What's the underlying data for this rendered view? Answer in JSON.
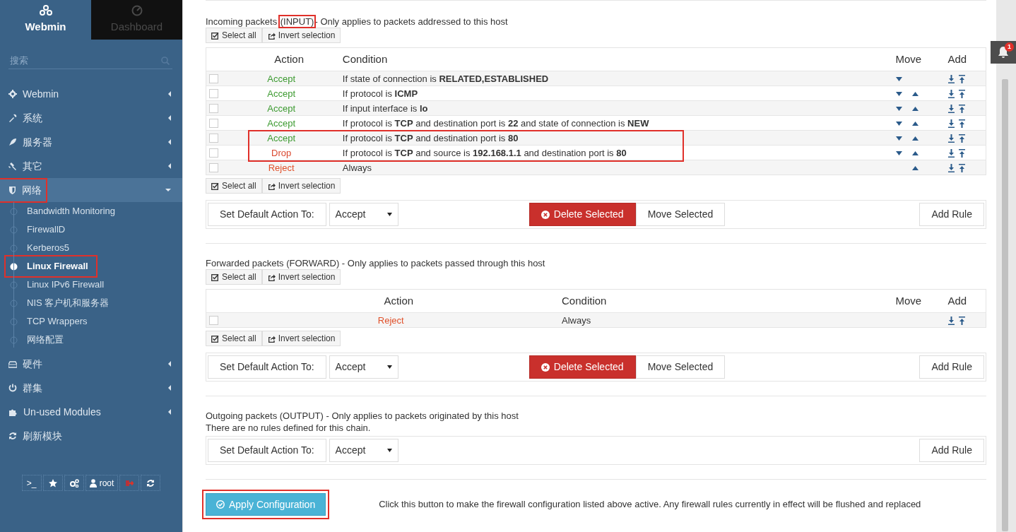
{
  "sidebar": {
    "tabs": [
      {
        "label": "Webmin",
        "selected": true
      },
      {
        "label": "Dashboard",
        "selected": false
      }
    ],
    "search": {
      "placeholder": "搜索"
    },
    "menu": [
      {
        "label": "Webmin",
        "expanded": false,
        "highlighted": false
      },
      {
        "label": "系统",
        "expanded": false,
        "highlighted": false
      },
      {
        "label": "服务器",
        "expanded": false,
        "highlighted": false
      },
      {
        "label": "其它",
        "expanded": false,
        "highlighted": false
      },
      {
        "label": "网络",
        "expanded": true,
        "highlighted": true,
        "children": [
          {
            "label": "Bandwidth Monitoring",
            "selected": false,
            "highlighted": false
          },
          {
            "label": "FirewallD",
            "selected": false,
            "highlighted": false
          },
          {
            "label": "Kerberos5",
            "selected": false,
            "highlighted": false
          },
          {
            "label": "Linux Firewall",
            "selected": true,
            "highlighted": true
          },
          {
            "label": "Linux IPv6 Firewall",
            "selected": false,
            "highlighted": false
          },
          {
            "label": "NIS 客户机和服务器",
            "selected": false,
            "highlighted": false
          },
          {
            "label": "TCP Wrappers",
            "selected": false,
            "highlighted": false
          },
          {
            "label": "网络配置",
            "selected": false,
            "highlighted": false
          }
        ]
      },
      {
        "label": "硬件",
        "expanded": false,
        "highlighted": false
      },
      {
        "label": "群集",
        "expanded": false,
        "highlighted": false
      },
      {
        "label": "Un-used Modules",
        "expanded": false,
        "highlighted": false
      },
      {
        "label": "刷新模块",
        "kind": "action",
        "highlighted": false
      }
    ],
    "footer": [
      {
        "kind": "terminal",
        "label": ">_"
      },
      {
        "kind": "star"
      },
      {
        "kind": "cogs"
      },
      {
        "kind": "user",
        "label": "root"
      },
      {
        "kind": "logout"
      },
      {
        "kind": "refresh"
      }
    ]
  },
  "notification": {
    "count": "1"
  },
  "chains": [
    {
      "title": [
        {
          "text": "Incoming packets ",
          "highlighted": false
        },
        {
          "text": "(INPUT)",
          "highlighted": true
        },
        {
          "text": "- Only applies to packets addressed to this host",
          "highlighted": false
        }
      ],
      "selection_bars": [
        {
          "select_all": "Select all",
          "invert_selection": "Invert selection"
        },
        {
          "select_all": "Select all",
          "invert_selection": "Invert selection"
        }
      ],
      "columns": {
        "action": "Action",
        "condition": "Condition",
        "move": "Move",
        "add": "Add"
      },
      "rules": [
        {
          "checked": false,
          "kind": "accept",
          "action": "Accept",
          "condition": "If state of connection is **RELATED,ESTABLISHED**",
          "move_down": true,
          "move_up": false,
          "highlighted": false
        },
        {
          "checked": false,
          "kind": "accept",
          "action": "Accept",
          "condition": "If protocol is **ICMP**",
          "move_down": true,
          "move_up": true,
          "highlighted": false
        },
        {
          "checked": false,
          "kind": "accept",
          "action": "Accept",
          "condition": "If input interface is **lo**",
          "move_down": true,
          "move_up": true,
          "highlighted": false
        },
        {
          "checked": false,
          "kind": "accept",
          "action": "Accept",
          "condition": "If protocol is **TCP** and destination port is **22** and state of connection is **NEW**",
          "move_down": true,
          "move_up": true,
          "highlighted": false
        },
        {
          "checked": false,
          "kind": "accept",
          "action": "Accept",
          "condition": "If protocol is **TCP** and destination port is **80**",
          "move_down": true,
          "move_up": true,
          "highlighted": true
        },
        {
          "checked": false,
          "kind": "drop",
          "action": "Drop",
          "condition": "If protocol is **TCP** and source is **192.168.1.1** and destination port is **80**",
          "move_down": true,
          "move_up": true,
          "highlighted": true
        },
        {
          "checked": false,
          "kind": "reject",
          "action": "Reject",
          "condition": "Always",
          "move_down": false,
          "move_up": true,
          "highlighted": false
        }
      ],
      "default_label": "Set Default Action To:",
      "default_action": "Accept",
      "delete_selected": "Delete Selected",
      "move_selected": "Move Selected",
      "add_rule": "Add Rule"
    },
    {
      "title": [
        {
          "text": "Forwarded packets (FORWARD) - Only applies to packets passed through this host",
          "highlighted": false
        }
      ],
      "selection_bars": [
        {
          "select_all": "Select all",
          "invert_selection": "Invert selection"
        },
        {
          "select_all": "Select all",
          "invert_selection": "Invert selection"
        }
      ],
      "columns": {
        "action": "Action",
        "condition": "Condition",
        "move": "Move",
        "add": "Add"
      },
      "rules": [
        {
          "checked": false,
          "kind": "reject",
          "action": "Reject",
          "condition": "Always",
          "move_down": false,
          "move_up": false,
          "highlighted": false
        }
      ],
      "default_label": "Set Default Action To:",
      "default_action": "Accept",
      "delete_selected": "Delete Selected",
      "move_selected": "Move Selected",
      "add_rule": "Add Rule"
    },
    {
      "title": [
        {
          "text": "Outgoing packets (OUTPUT) - Only applies to packets originated by this host",
          "highlighted": false
        }
      ],
      "empty_message": "There are no rules defined for this chain.",
      "default_label": "Set Default Action To:",
      "default_action": "Accept",
      "add_rule": "Add Rule"
    }
  ],
  "apply": {
    "label": "Apply Configuration",
    "highlighted": true,
    "note": "Click this button to make the firewall configuration listed above active. Any firewall rules currently in effect will be flushed and replaced"
  }
}
